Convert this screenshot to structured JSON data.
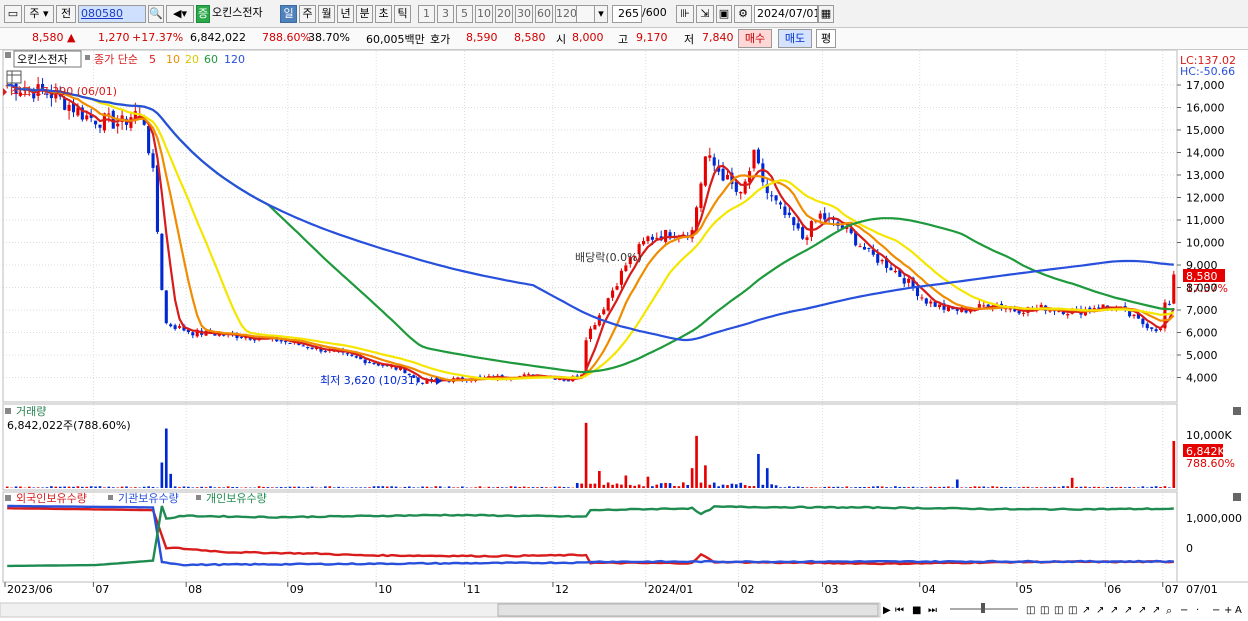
{
  "toolbar": {
    "type_label": "주",
    "jeon_label": "전",
    "code_value": "080580",
    "stock_name": "오킨스전자",
    "tabs": [
      "일",
      "주",
      "월",
      "년",
      "분",
      "초",
      "틱"
    ],
    "active_tab": "일",
    "periods": [
      "1",
      "3",
      "5",
      "10",
      "20",
      "30",
      "60",
      "120"
    ],
    "count_value": "265",
    "count_total": "/600",
    "date_value": "2024/07/01"
  },
  "quote": {
    "price": "8,580",
    "change": "1,270",
    "change_pct": "+17.37%",
    "volume": "6,842,022",
    "volume_pct": "788.60%",
    "turnover": "38.70%",
    "amount": "60,005백만",
    "bid_label": "호가",
    "bid1": "8,590",
    "bid2": "8,580",
    "open_label": "시",
    "open": "8,000",
    "high_label": "고",
    "high": "9,170",
    "low_label": "저",
    "low": "7,840",
    "buy_label": "매수",
    "sell_label": "매도",
    "eval_label": "평"
  },
  "price_panel": {
    "name_box": "오킨스전자",
    "legend_main": "종가 단순",
    "ma_periods": [
      "5",
      "10",
      "20",
      "60",
      "120"
    ],
    "ma_colors": [
      "#d81b1b",
      "#f08c00",
      "#f5e600",
      "#1e9a3c",
      "#2850dc"
    ],
    "lc_label": "LC:137.02",
    "hc_label": "HC:-50.66",
    "high_annotation": "최고 17,390 (06/01)",
    "low_annotation": "최저 3,620 (10/31)",
    "dividend_annotation": "배당락(0.0%)",
    "last_price": "8,580",
    "last_pct": "17.37%"
  },
  "volume_panel": {
    "title": "거래량",
    "value": "6,842,022주(788.60%)",
    "axis_label": "10,000K",
    "last_value": "6,842K",
    "last_pct": "788.60%"
  },
  "holdings_panel": {
    "legend": [
      "외국인보유수량",
      "기관보유수량",
      "개인보유수량"
    ],
    "colors": [
      "#d81b1b",
      "#2850dc",
      "#1e8c50"
    ],
    "axis_ticks": [
      "1,000,000",
      "0"
    ]
  },
  "x_axis": [
    "2023/06",
    "07",
    "08",
    "09",
    "10",
    "11",
    "12",
    "2024/01",
    "02",
    "03",
    "04",
    "05",
    "06",
    "07"
  ],
  "x_axis_right": "07/01",
  "colors": {
    "up": "#e60000",
    "down": "#0028d2",
    "grid": "#dcdcdc"
  },
  "chart_data": {
    "type": "candlestick",
    "y_ticks": [
      4000,
      5000,
      6000,
      7000,
      8000,
      9000,
      10000,
      11000,
      12000,
      13000,
      14000,
      15000,
      16000,
      17000
    ],
    "y_range": [
      3000,
      18200
    ],
    "close_anchors": [
      [
        0,
        17000
      ],
      [
        10,
        16600
      ],
      [
        15,
        16000
      ],
      [
        18,
        15600
      ],
      [
        22,
        15400
      ],
      [
        26,
        15300
      ],
      [
        29,
        15800
      ],
      [
        31,
        15400
      ],
      [
        33,
        13000
      ],
      [
        35,
        8000
      ],
      [
        36,
        6400
      ],
      [
        42,
        6000
      ],
      [
        50,
        5900
      ],
      [
        60,
        5700
      ],
      [
        70,
        5300
      ],
      [
        80,
        4800
      ],
      [
        90,
        4300
      ],
      [
        93,
        3800
      ],
      [
        100,
        3900
      ],
      [
        110,
        4000
      ],
      [
        120,
        4100
      ],
      [
        127,
        3900
      ],
      [
        130,
        4200
      ],
      [
        131,
        5800
      ],
      [
        134,
        6800
      ],
      [
        140,
        9000
      ],
      [
        145,
        10200
      ],
      [
        150,
        10400
      ],
      [
        155,
        10500
      ],
      [
        158,
        13800
      ],
      [
        162,
        13000
      ],
      [
        166,
        12000
      ],
      [
        169,
        13800
      ],
      [
        172,
        12200
      ],
      [
        176,
        11200
      ],
      [
        180,
        10200
      ],
      [
        184,
        11200
      ],
      [
        190,
        10500
      ],
      [
        195,
        9500
      ],
      [
        200,
        8900
      ],
      [
        204,
        8200
      ],
      [
        208,
        7400
      ],
      [
        213,
        7000
      ],
      [
        218,
        7000
      ],
      [
        223,
        7300
      ],
      [
        228,
        7000
      ],
      [
        235,
        7100
      ],
      [
        242,
        6900
      ],
      [
        247,
        7200
      ],
      [
        252,
        7000
      ],
      [
        257,
        6400
      ],
      [
        261,
        6100
      ],
      [
        262,
        7300
      ],
      [
        263,
        7100
      ],
      [
        264,
        8580
      ]
    ],
    "volume_spikes": [
      [
        36,
        10500
      ],
      [
        35,
        4500
      ],
      [
        37,
        2500
      ],
      [
        131,
        11500
      ],
      [
        134,
        3000
      ],
      [
        140,
        2200
      ],
      [
        145,
        2000
      ],
      [
        155,
        3500
      ],
      [
        156,
        9200
      ],
      [
        158,
        4000
      ],
      [
        170,
        6000
      ],
      [
        172,
        3500
      ],
      [
        215,
        1500
      ],
      [
        241,
        1800
      ],
      [
        264,
        8300
      ]
    ],
    "holdings": {
      "foreign": [
        [
          0,
          1420000
        ],
        [
          20,
          1380000
        ],
        [
          33,
          1350000
        ],
        [
          36,
          -10000
        ],
        [
          38,
          0
        ],
        [
          50,
          -150000
        ],
        [
          70,
          -200000
        ],
        [
          80,
          -260000
        ],
        [
          110,
          -290000
        ],
        [
          131,
          -250000
        ],
        [
          132,
          -530000
        ],
        [
          155,
          -540000
        ],
        [
          157,
          -230000
        ],
        [
          160,
          -500000
        ],
        [
          200,
          -560000
        ],
        [
          230,
          -500000
        ],
        [
          264,
          -490000
        ]
      ],
      "institution": [
        [
          0,
          1500000
        ],
        [
          33,
          1450000
        ],
        [
          35,
          -500000
        ],
        [
          40,
          -600000
        ],
        [
          131,
          -520000
        ],
        [
          132,
          -490000
        ],
        [
          264,
          -480000
        ]
      ],
      "retail": [
        [
          0,
          -640000
        ],
        [
          20,
          -610000
        ],
        [
          33,
          -450000
        ],
        [
          35,
          1500000
        ],
        [
          36,
          1050000
        ],
        [
          40,
          1150000
        ],
        [
          60,
          1100000
        ],
        [
          100,
          1180000
        ],
        [
          131,
          1120000
        ],
        [
          132,
          1350000
        ],
        [
          155,
          1420000
        ],
        [
          157,
          1200000
        ],
        [
          160,
          1470000
        ],
        [
          200,
          1440000
        ],
        [
          230,
          1380000
        ],
        [
          264,
          1400000
        ]
      ]
    }
  }
}
